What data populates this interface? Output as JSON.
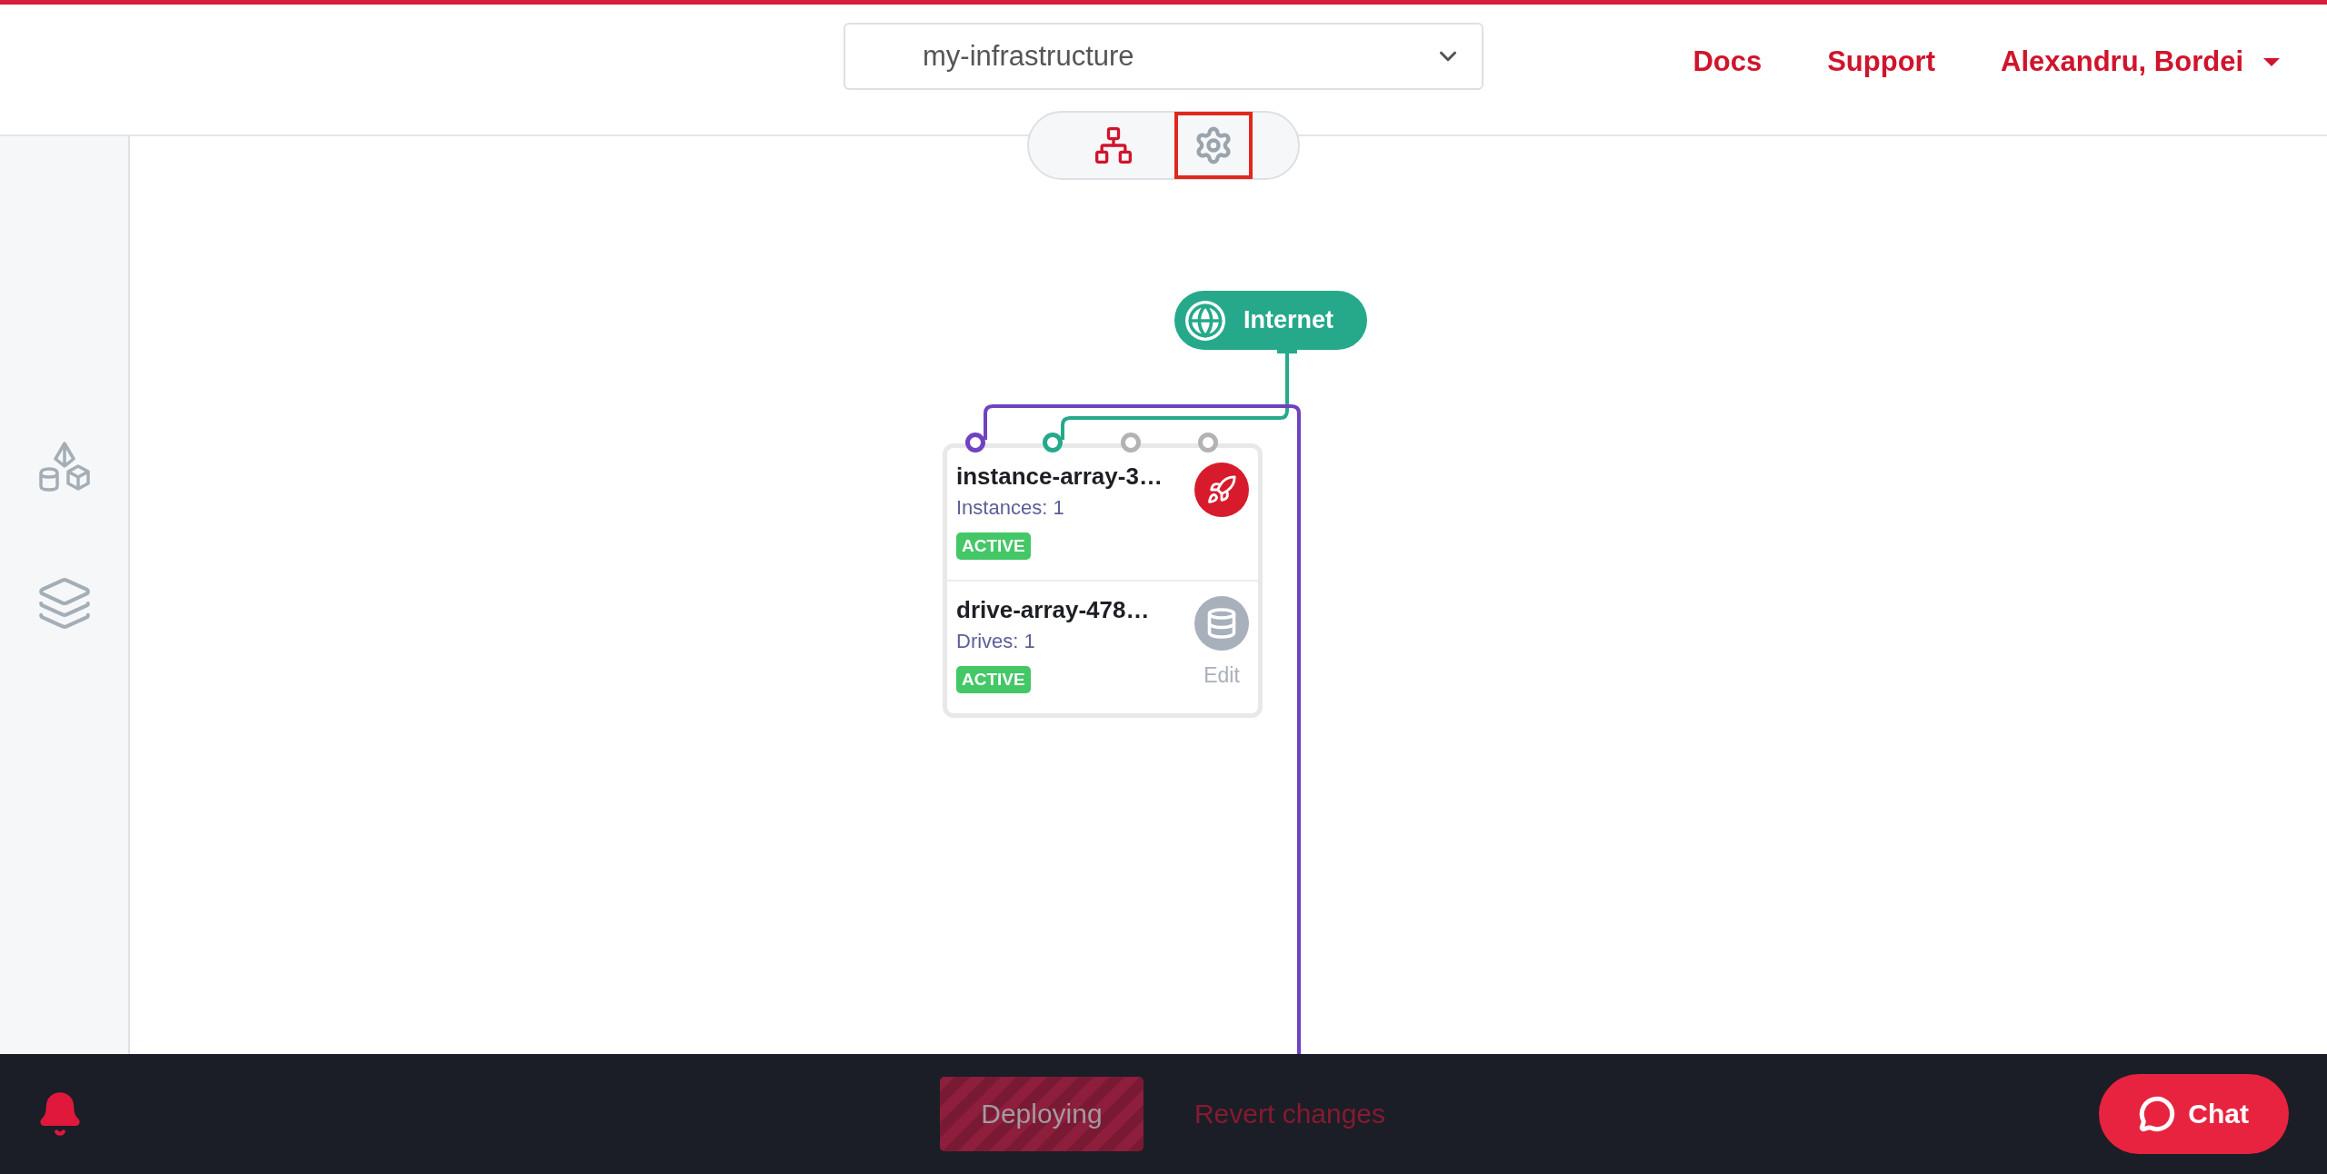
{
  "header": {
    "infrastructure_select": {
      "value": "my-infrastructure"
    },
    "links": [
      {
        "label": "Docs"
      },
      {
        "label": "Support"
      }
    ],
    "user_menu": {
      "label": "Alexandru, Bordei"
    }
  },
  "view_toggle": [
    {
      "kind": "topology",
      "selected": false
    },
    {
      "kind": "settings",
      "selected": true
    }
  ],
  "sidebar": {
    "items": [
      {
        "kind": "products"
      },
      {
        "kind": "layers"
      }
    ]
  },
  "canvas": {
    "internet_node": {
      "label": "Internet"
    },
    "card": {
      "ports": [
        {
          "color": "#6f42c1"
        },
        {
          "color": "#26a98b"
        },
        {
          "color": "#b3b3b3"
        },
        {
          "color": "#b3b3b3"
        }
      ],
      "sections": [
        {
          "kind": "instance",
          "name": "instance-array-3…",
          "detail": "Instances: 1",
          "status": "ACTIVE"
        },
        {
          "kind": "drive",
          "name": "drive-array-478…",
          "detail": "Drives: 1",
          "status": "ACTIVE",
          "action": "Edit"
        }
      ]
    }
  },
  "bottom_bar": {
    "deploy_button": {
      "label": "Deploying",
      "disabled": true
    },
    "revert_link": {
      "label": "Revert changes",
      "disabled": true
    },
    "chat_button": {
      "label": "Chat"
    }
  }
}
